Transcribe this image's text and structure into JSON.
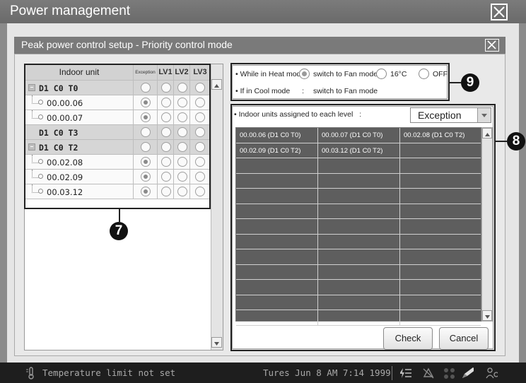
{
  "window": {
    "title": "Power management"
  },
  "dialog": {
    "title": "Peak power control setup - Priority control mode"
  },
  "tree": {
    "header": {
      "name": "Indoor unit",
      "exception": "Exception",
      "lv1": "LV1",
      "lv2": "LV2",
      "lv3": "LV3"
    },
    "rows": [
      {
        "label": "D1 C0 T0",
        "type": "group",
        "exception": false
      },
      {
        "label": "00.00.06",
        "type": "unit",
        "exception": true
      },
      {
        "label": "00.00.07",
        "type": "unit",
        "exception": true
      },
      {
        "label": "D1 C0 T3",
        "type": "group-plain",
        "exception": false
      },
      {
        "label": "D1 C0 T2",
        "type": "group",
        "exception": false
      },
      {
        "label": "00.02.08",
        "type": "unit",
        "exception": true
      },
      {
        "label": "00.02.09",
        "type": "unit",
        "exception": true
      },
      {
        "label": "00.03.12",
        "type": "unit",
        "exception": true
      }
    ]
  },
  "heat_mode": {
    "label": "While in Heat mode",
    "colon": ":",
    "options": [
      "switch to Fan mode",
      "16°C",
      "OFF"
    ],
    "selected": "switch to Fan mode"
  },
  "cool_mode": {
    "label": "If in Cool mode",
    "colon": ":",
    "value": "switch to Fan mode"
  },
  "level_panel": {
    "caption": "Indoor units assigned to each level",
    "colon": ":",
    "selected_level": "Exception",
    "cells": [
      [
        "00.00.06 (D1 C0 T0)",
        "00.00.07 (D1 C0 T0)",
        "00.02.08 (D1 C0 T2)"
      ],
      [
        "00.02.09 (D1 C0 T2)",
        "00.03.12 (D1 C0 T2)",
        ""
      ]
    ],
    "check_label": "Check",
    "cancel_label": "Cancel"
  },
  "callouts": {
    "tree": "7",
    "level_grid": "8",
    "heat_mode": "9"
  },
  "statusbar": {
    "message": "Temperature limit not set",
    "datetime": "Tures Jun 8 AM 7:14 1999"
  }
}
